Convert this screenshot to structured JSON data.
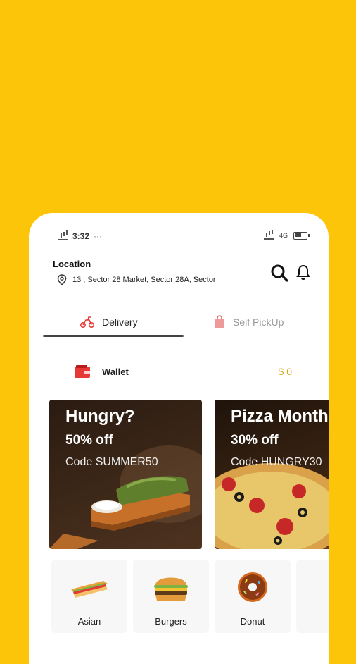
{
  "status_bar": {
    "time": "3:32",
    "left_extra": "··· ",
    "network": "4G"
  },
  "header": {
    "location_title": "Location",
    "address": "13 , Sector 28 Market, Sector 28A, Sector"
  },
  "tabs": [
    {
      "label": "Delivery",
      "active": true
    },
    {
      "label": "Self PickUp",
      "active": false
    }
  ],
  "wallet": {
    "label": "Wallet",
    "amount": "$ 0"
  },
  "banners": [
    {
      "title": "Hungry?",
      "discount": "50% off",
      "code": "Code SUMMER50"
    },
    {
      "title": "Pizza Month",
      "discount": "30% off",
      "code": "Code HUNGRY30"
    }
  ],
  "categories": [
    {
      "label": "Asian",
      "icon": "sandwich-icon"
    },
    {
      "label": "Burgers",
      "icon": "burger-icon"
    },
    {
      "label": "Donut",
      "icon": "donut-icon"
    }
  ],
  "colors": {
    "background": "#FDC50A",
    "accent_red": "#E53935",
    "wallet_amount": "#D4A820"
  }
}
